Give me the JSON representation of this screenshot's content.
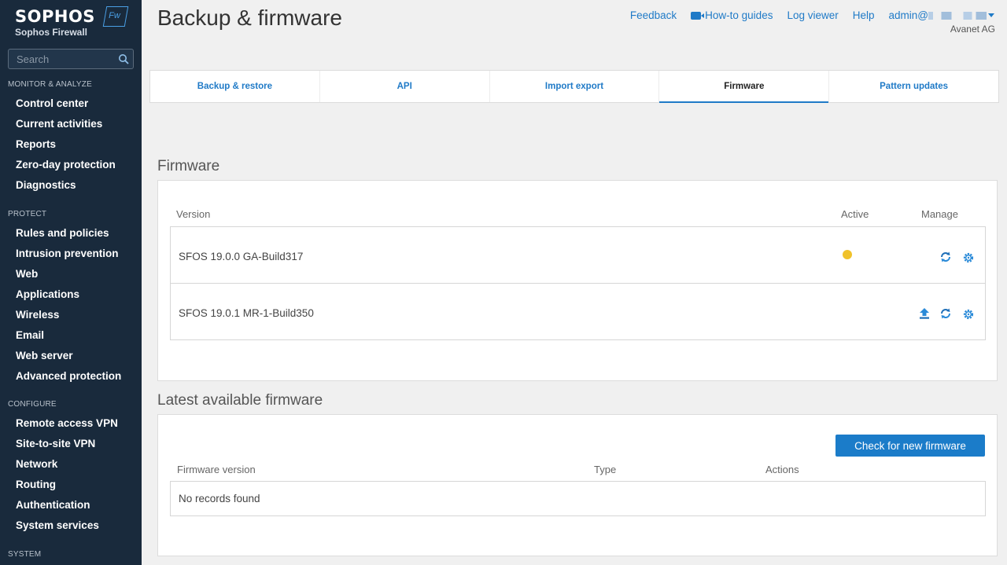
{
  "brand": {
    "name": "SOPHOS",
    "product": "Sophos Firewall",
    "badge": "Fw"
  },
  "search": {
    "placeholder": "Search"
  },
  "sidebar": {
    "sections": [
      {
        "label": "MONITOR & ANALYZE",
        "items": [
          "Control center",
          "Current activities",
          "Reports",
          "Zero-day protection",
          "Diagnostics"
        ]
      },
      {
        "label": "PROTECT",
        "items": [
          "Rules and policies",
          "Intrusion prevention",
          "Web",
          "Applications",
          "Wireless",
          "Email",
          "Web server",
          "Advanced protection"
        ]
      },
      {
        "label": "CONFIGURE",
        "items": [
          "Remote access VPN",
          "Site-to-site VPN",
          "Network",
          "Routing",
          "Authentication",
          "System services"
        ]
      },
      {
        "label": "SYSTEM",
        "items": []
      }
    ]
  },
  "header": {
    "title": "Backup & firmware",
    "links": {
      "feedback": "Feedback",
      "guides": "How-to guides",
      "log": "Log viewer",
      "help": "Help",
      "admin": "admin@"
    },
    "company": "Avanet AG"
  },
  "tabs": [
    {
      "label": "Backup & restore",
      "active": false
    },
    {
      "label": "API",
      "active": false
    },
    {
      "label": "Import export",
      "active": false
    },
    {
      "label": "Firmware",
      "active": true
    },
    {
      "label": "Pattern updates",
      "active": false
    }
  ],
  "firmware": {
    "heading": "Firmware",
    "columns": {
      "version": "Version",
      "active": "Active",
      "manage": "Manage"
    },
    "rows": [
      {
        "version": "SFOS 19.0.0 GA-Build317",
        "active": true
      },
      {
        "version": "SFOS 19.0.1 MR-1-Build350",
        "active": false
      }
    ]
  },
  "latest": {
    "heading": "Latest available firmware",
    "button": "Check for new firmware",
    "columns": {
      "version": "Firmware version",
      "type": "Type",
      "actions": "Actions"
    },
    "empty": "No records found"
  },
  "colors": {
    "sidebar": "#192a3c",
    "accent": "#1f7ac7",
    "active_dot": "#f0c22b"
  }
}
